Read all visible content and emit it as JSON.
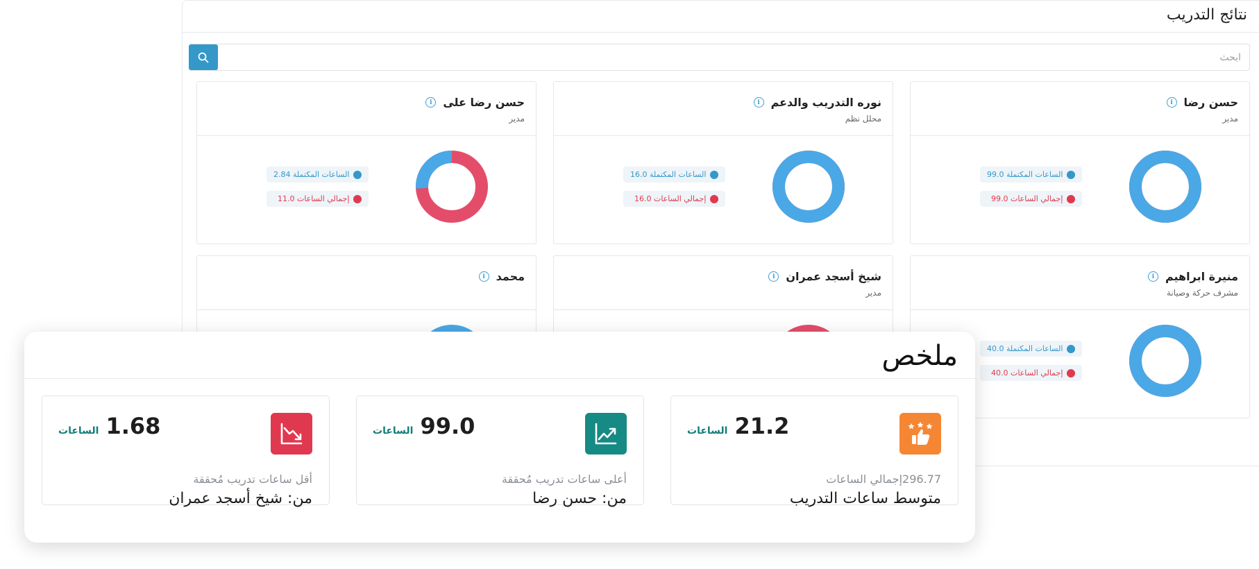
{
  "panel": {
    "title": "نتائج التدريب"
  },
  "search": {
    "placeholder": "ابحث"
  },
  "cards": [
    {
      "name": "حسن رضا",
      "role": "مدير",
      "completed_label": "الساعات المكتملة 99.0",
      "total_label": "إجمالي الساعات 99.0",
      "completed": 99.0,
      "total": 99.0
    },
    {
      "name": "نوره التدريب والدعم",
      "role": "محلل نظم",
      "completed_label": "الساعات المكتملة 16.0",
      "total_label": "إجمالي الساعات 16.0",
      "completed": 16.0,
      "total": 16.0
    },
    {
      "name": "حسن رضا على",
      "role": "مدير",
      "completed_label": "الساعات المكتملة 2.84",
      "total_label": "إجمالي الساعات 11.0",
      "completed": 2.84,
      "total": 11.0
    },
    {
      "name": "منيرة ابراهيم",
      "role": "مشرف حركة وصيانة",
      "completed_label": "الساعات المكتملة 40.0",
      "total_label": "إجمالي الساعات 40.0",
      "completed": 40.0,
      "total": 40.0
    },
    {
      "name": "شيخ أسجد عمران",
      "role": "مدير"
    },
    {
      "name": "محمد",
      "role": ""
    }
  ],
  "summary": {
    "title": "ملخص",
    "unit": "الساعات",
    "stats": [
      {
        "value": "21.2",
        "sub": "296.77إجمالي الساعات",
        "main": "متوسط ساعات التدريب",
        "icon": "thumbs-up-stars-icon",
        "color": "#f58634"
      },
      {
        "value": "99.0",
        "sub": "أعلى ساعات تدريب مُحققة",
        "main": "من: حسن رضا",
        "icon": "trend-up-icon",
        "color": "#168a84"
      },
      {
        "value": "1.68",
        "sub": "أقل ساعات تدريب مُحققة",
        "main": "من: شيخ أسجد عمران",
        "icon": "trend-down-icon",
        "color": "#e0394f"
      }
    ]
  },
  "colors": {
    "completed": "#4aa8e6",
    "remaining": "#e44d6a",
    "accent": "#3498c9"
  }
}
